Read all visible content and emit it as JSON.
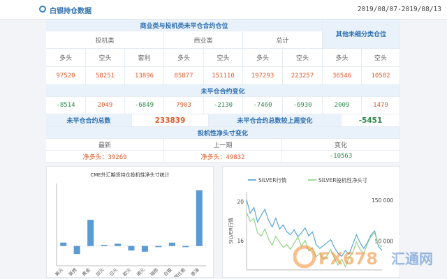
{
  "header": {
    "title": "白银持仓数据",
    "date_range": "2019/08/07-2019/08/13"
  },
  "table": {
    "group_header": "商业类与投机类未平仓合约仓位",
    "other_header": "其他未细分类仓位",
    "sub_headers": [
      "投机类",
      "商业类",
      "总计"
    ],
    "col_labels": [
      "多头",
      "空头",
      "套利",
      "多头",
      "空头",
      "多头",
      "空头",
      "多头",
      "空头"
    ],
    "values": [
      "97520",
      "58251",
      "13896",
      "85877",
      "151110",
      "197293",
      "223257",
      "36546",
      "10582"
    ],
    "change_header": "未平仓合约变化",
    "changes": [
      "-8514",
      "2049",
      "-6849",
      "7903",
      "-2130",
      "-7460",
      "-6930",
      "2009",
      "1479"
    ],
    "oi_total_label": "未平仓合约总数",
    "oi_total_value": "233839",
    "oi_change_label": "未平仓合约总数较上周变化",
    "oi_change_value": "-5451",
    "spec_header": "投机性净头寸变化",
    "spec_col_labels": [
      "最新",
      "上一期",
      "变化"
    ],
    "spec_latest": "净多头：39269",
    "spec_previous": "净多头：49832",
    "spec_change": "-10563"
  },
  "bar_panel": {
    "colors": {
      "bar": "#5b9bd5",
      "axis": "#999999"
    }
  },
  "chart_data": [
    {
      "type": "bar",
      "title": "CME外汇期货持仓投机性净头寸统计",
      "categories": [
        "美元",
        "英镑",
        "黄金",
        "加元",
        "日元",
        "欧元",
        "澳元",
        "瑞郎",
        "白银",
        "墨西哥比索",
        "原油"
      ],
      "values": [
        3,
        -7,
        23,
        1,
        2,
        -4,
        -5,
        -1,
        3,
        -1,
        49
      ],
      "ylim": [
        -10,
        55
      ]
    },
    {
      "type": "line",
      "legend": [
        "SILVER行情",
        "SILVER投机性净头寸"
      ],
      "legend_position": "top",
      "ylabel": "SILVER行情",
      "left_axis": {
        "ticks": [
          "20",
          "16"
        ],
        "range": [
          13,
          21
        ]
      },
      "right_axis": {
        "ticks": [
          "150 000",
          "50 000"
        ],
        "range": [
          -20000,
          170000
        ]
      },
      "series": [
        {
          "name": "SILVER行情",
          "color": "#4a9fd8",
          "axis": "left",
          "values": [
            20.2,
            18.8,
            19.4,
            17.9,
            18.6,
            19.2,
            18.1,
            17.4,
            18.3,
            17.2,
            17.6,
            16.9,
            16.6,
            17.1,
            16.4,
            16.8,
            17.3,
            16.5,
            16.9,
            15.6,
            15.2,
            15.5,
            15.8,
            16.1,
            15.3,
            14.7,
            14.4,
            15.0,
            14.6,
            15.6,
            16.6,
            15.8,
            15.2,
            15.8,
            16.6,
            17.0,
            15.4,
            15.0
          ]
        },
        {
          "name": "SILVER投机性净头寸",
          "color": "#8ccf7e",
          "axis": "right",
          "values": [
            120000,
            98000,
            105000,
            70000,
            62000,
            80000,
            55000,
            40000,
            62000,
            48000,
            35000,
            42000,
            30000,
            45000,
            60000,
            38000,
            52000,
            26000,
            34000,
            12000,
            20000,
            5000,
            15000,
            30000,
            8000,
            -8000,
            6000,
            -12000,
            10000,
            22000,
            48000,
            30000,
            20000,
            44000,
            62000,
            70000,
            40000,
            36000
          ]
        }
      ]
    }
  ],
  "watermark": {
    "text": "FX678",
    "sub": "汇通网",
    "colors": {
      "brand_orange": "#f28a2e",
      "brand_blue": "#3d78c8"
    }
  }
}
